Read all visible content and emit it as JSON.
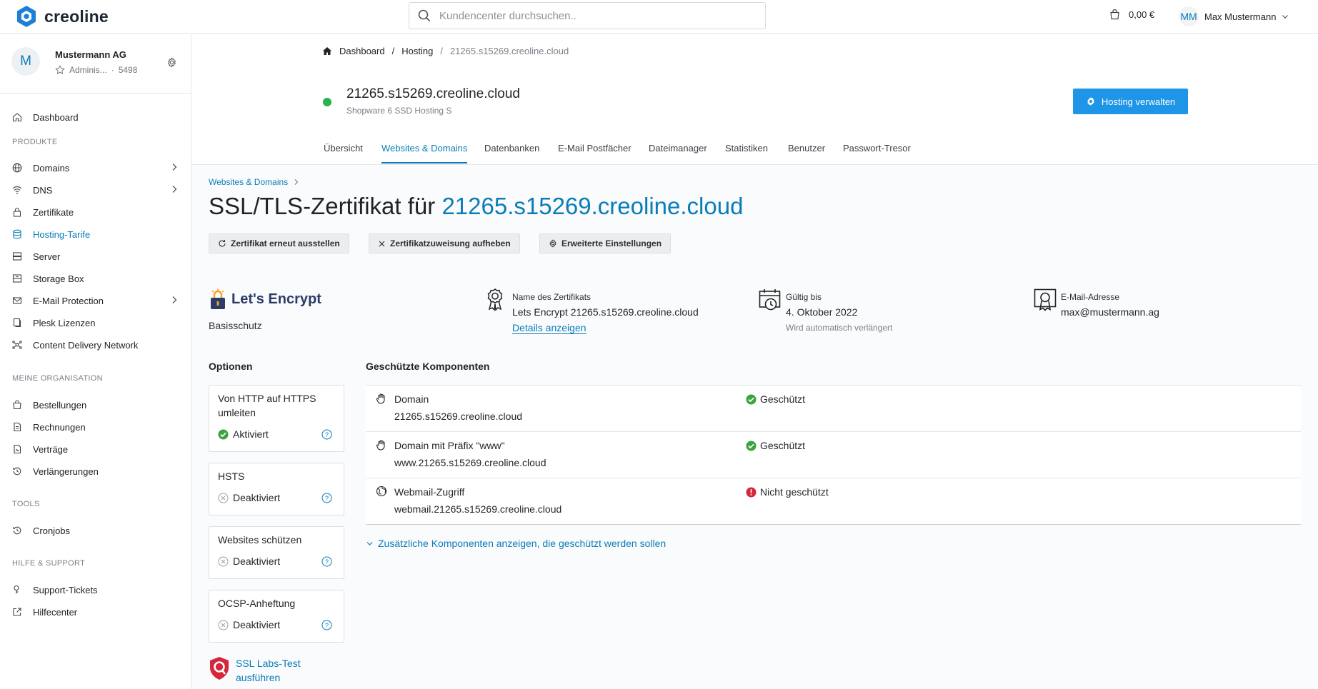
{
  "app": {
    "logo_text": "creoline",
    "search_placeholder": "Kundencenter durchsuchen..",
    "cart_total": "0,00 €",
    "user_initials": "MM",
    "user_name": "Max Mustermann",
    "accent_color": "#0a7cb8",
    "button_color": "#1e95e6"
  },
  "sidebar": {
    "org": {
      "initial": "M",
      "name": "Mustermann AG",
      "role": "Adminis...",
      "separator": "·",
      "id": "5498"
    },
    "dashboard_label": "Dashboard",
    "sections": {
      "produkte": "PRODUKTE",
      "organisation": "MEINE ORGANISATION",
      "tools": "TOOLS",
      "support": "HILFE & SUPPORT"
    },
    "produkte_items": [
      {
        "label": "Domains",
        "icon": "globe-icon"
      },
      {
        "label": "DNS",
        "icon": "wifi-icon"
      },
      {
        "label": "Zertifikate",
        "icon": "lock-icon"
      },
      {
        "label": "Hosting-Tarife",
        "icon": "database-icon"
      },
      {
        "label": "Server",
        "icon": "server-icon"
      },
      {
        "label": "Storage Box",
        "icon": "storage-icon"
      },
      {
        "label": "E-Mail Protection",
        "icon": "mail-icon"
      },
      {
        "label": "Plesk Lizenzen",
        "icon": "license-icon"
      },
      {
        "label": "Content Delivery Network",
        "icon": "network-icon"
      }
    ],
    "org_items": [
      {
        "label": "Bestellungen",
        "icon": "bag-icon"
      },
      {
        "label": "Rechnungen",
        "icon": "invoice-icon"
      },
      {
        "label": "Verträge",
        "icon": "contract-icon"
      },
      {
        "label": "Verlängerungen",
        "icon": "history-icon"
      }
    ],
    "tools_items": [
      {
        "label": "Cronjobs",
        "icon": "history-icon"
      }
    ],
    "support_items": [
      {
        "label": "Support-Tickets",
        "icon": "ticket-icon"
      },
      {
        "label": "Hilfecenter",
        "icon": "external-icon"
      }
    ]
  },
  "breadcrumb": {
    "items": [
      "Dashboard",
      "Hosting",
      "21265.s15269.creoline.cloud"
    ],
    "separator": "/"
  },
  "hosting": {
    "title": "21265.s15269.creoline.cloud",
    "subtitle": "Shopware 6 SSD Hosting S",
    "status_color": "#2bb24c",
    "manage_button": "Hosting verwalten"
  },
  "tabs": [
    "Übersicht",
    "Websites & Domains",
    "Datenbanken",
    "E-Mail Postfächer",
    "Dateimanager",
    "Statistiken",
    "Benutzer",
    "Passwort-Tresor"
  ],
  "active_tab": "Websites & Domains",
  "cert_page": {
    "sub_breadcrumb": "Websites & Domains",
    "title_prefix": "SSL/TLS-Zertifikat für",
    "title_domain": "21265.s15269.creoline.cloud",
    "actions": [
      {
        "label": "Zertifikat erneut ausstellen",
        "icon": "refresh-icon"
      },
      {
        "label": "Zertifikatzuweisung aufheben",
        "icon": "close-icon"
      },
      {
        "label": "Erweiterte Einstellungen",
        "icon": "gear-icon"
      }
    ],
    "provider": {
      "name": "Let's Encrypt",
      "tier": "Basisschutz"
    },
    "cert_name": {
      "label": "Name des Zertifikats",
      "value": "Lets Encrypt 21265.s15269.creoline.cloud",
      "link": "Details anzeigen"
    },
    "valid_until": {
      "label": "Gültig bis",
      "value": "4. Oktober 2022",
      "note": "Wird automatisch verlängert"
    },
    "email": {
      "label": "E-Mail-Adresse",
      "value": "max@mustermann.ag"
    }
  },
  "options": {
    "heading": "Optionen",
    "items": [
      {
        "title": "Von HTTP auf HTTPS umleiten",
        "state": "Aktiviert",
        "enabled": true
      },
      {
        "title": "HSTS",
        "state": "Deaktiviert",
        "enabled": false
      },
      {
        "title": "Websites schützen",
        "state": "Deaktiviert",
        "enabled": false
      },
      {
        "title": "OCSP-Anheftung",
        "state": "Deaktiviert",
        "enabled": false
      }
    ],
    "ssl_labs_line1": "SSL Labs-Test",
    "ssl_labs_line2": "ausführen"
  },
  "components": {
    "heading": "Geschützte Komponenten",
    "rows": [
      {
        "name": "Domain",
        "host": "21265.s15269.creoline.cloud",
        "status": "Geschützt",
        "protected": true,
        "icon": "hand-icon"
      },
      {
        "name": "Domain mit Präfix \"www\"",
        "host": "www.21265.s15269.creoline.cloud",
        "status": "Geschützt",
        "protected": true,
        "icon": "hand-icon"
      },
      {
        "name": "Webmail-Zugriff",
        "host": "webmail.21265.s15269.creoline.cloud",
        "status": "Nicht geschützt",
        "protected": false,
        "icon": "globe-icon"
      }
    ],
    "more_link": "Zusätzliche Komponenten anzeigen, die geschützt werden sollen",
    "ok_color": "#3aa53c",
    "error_color": "#d6263a"
  }
}
